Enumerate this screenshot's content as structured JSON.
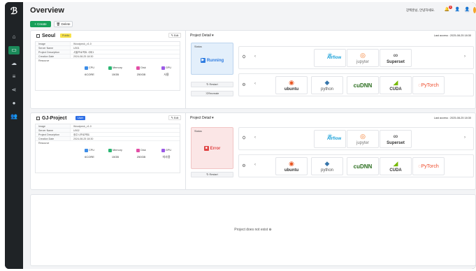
{
  "header": {
    "title": "Overview",
    "greeting": "강백훈님, 안녕하세요.",
    "notification_count": "1"
  },
  "toolbar": {
    "create_label": "+ Create",
    "delete_label": "Delete"
  },
  "labels": {
    "image": "Image",
    "server_name": "Server Name",
    "project_description": "Project Description",
    "creation_date": "Creation Date",
    "resource": "Resource",
    "project_detail": "Project Detail",
    "status": "Status",
    "edit": "Edit",
    "restart": "Restart",
    "recreate": "Recreate",
    "cpu": "CPU",
    "memory": "Memory",
    "disk": "Disk",
    "gpu": "GPU"
  },
  "projects": [
    {
      "name": "Seoul",
      "tag": "Public",
      "image": "Woodpeck_v1.0",
      "server_name": "U001",
      "description": "서울프로젝트 서버1",
      "creation_date": "2024-08-25 18:30",
      "cpu": "6CORE",
      "memory": "15GB",
      "disk": "250GB",
      "gpu": "사용",
      "last_access": "Last access : 2025-08-25 18:30",
      "status": "Running"
    },
    {
      "name": "GJ-Project",
      "tag": "User",
      "image": "Woodpeck_v1.0",
      "server_name": "U002",
      "description": "광주시프로젝트",
      "creation_date": "2024-08-25 18:30",
      "cpu": "6CORE",
      "memory": "15GB",
      "disk": "250GB",
      "gpu": "미사용",
      "last_access": "Last access : 2025-08-25 18:30",
      "status": "Error"
    }
  ],
  "tools_row1": [
    "Airflow",
    "jupyter",
    "Superset"
  ],
  "tools_row2": [
    "ubuntu",
    "python",
    "cuDNN",
    "CUDA",
    "PyTorch"
  ],
  "empty_message": "Project does not exist",
  "colors": {
    "accent": "#17a05a",
    "running": "#2d7be0",
    "error": "#e04545",
    "sidebar": "#1f2326"
  }
}
